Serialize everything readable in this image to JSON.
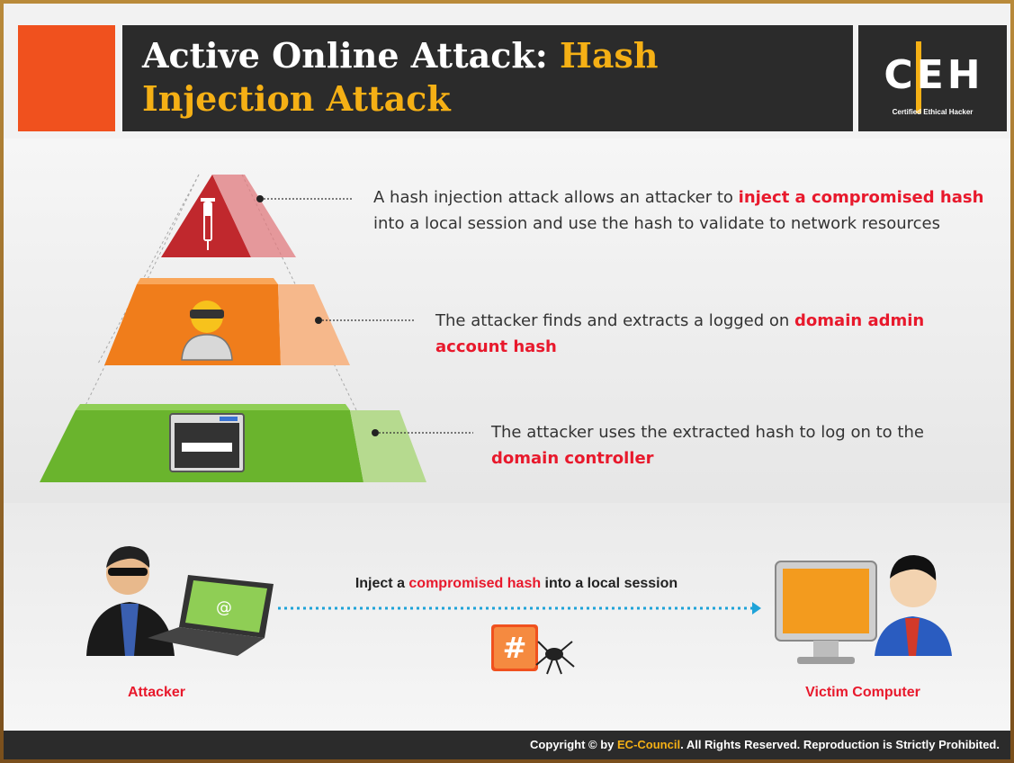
{
  "title": {
    "part1": "Active Online Attack: ",
    "part2": "Hash",
    "part3": "Injection Attack"
  },
  "logo": {
    "letters": "CEH",
    "subtitle": "Certified Ethical Hacker"
  },
  "steps": [
    {
      "pre": "A hash injection attack allows an attacker to ",
      "highlight": "inject a compromised hash",
      "post": " into a local session and use the hash to validate to network resources"
    },
    {
      "pre": "The attacker finds and extracts a logged on ",
      "highlight": "domain admin account hash",
      "post": ""
    },
    {
      "pre": "The attacker uses the extracted hash to log on to the ",
      "highlight": "domain controller",
      "post": ""
    }
  ],
  "flow": {
    "pre": "Inject a ",
    "highlight": "compromised hash",
    "post": " into a local session",
    "attacker_label": "Attacker",
    "victim_label": "Victim Computer",
    "hash_symbol": "#",
    "laptop_symbol": "@"
  },
  "colors": {
    "accent_red": "#e8192c",
    "accent_orange": "#f0511e",
    "accent_yellow": "#f5b015",
    "tier1": "#c0282d",
    "tier2": "#f07d1b",
    "tier3": "#6ab42d"
  },
  "footer": {
    "pre": "Copyright © by ",
    "brand": "EC-Council",
    "post": ". All Rights Reserved. Reproduction is Strictly Prohibited."
  }
}
